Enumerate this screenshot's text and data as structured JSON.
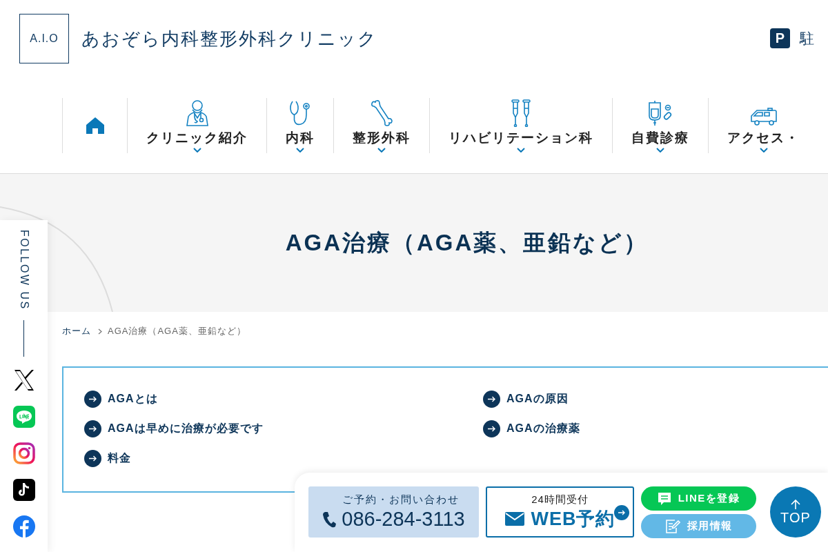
{
  "header": {
    "logo": "A.I.O",
    "clinic_name": "あおぞら内科整形外科クリニック",
    "parking_icon": "P",
    "parking_label": "駐"
  },
  "nav": [
    {
      "kind": "home",
      "has_submenu": false
    },
    {
      "kind": "doctor",
      "label": "クリニック紹介",
      "has_submenu": true
    },
    {
      "kind": "stethoscope",
      "label": "内科",
      "has_submenu": true
    },
    {
      "kind": "bone",
      "label": "整形外科",
      "has_submenu": true
    },
    {
      "kind": "crutches",
      "label": "リハビリテーション科",
      "has_submenu": true
    },
    {
      "kind": "drip",
      "label": "自費診療",
      "has_submenu": true
    },
    {
      "kind": "car",
      "label": "アクセス・",
      "has_submenu": true
    }
  ],
  "hero": {
    "title": "AGA治療（AGA薬、亜鉛など）"
  },
  "follow": {
    "label": "FOLLOW US",
    "links": [
      {
        "kind": "x"
      },
      {
        "kind": "line"
      },
      {
        "kind": "instagram"
      },
      {
        "kind": "tiktok"
      },
      {
        "kind": "facebook"
      }
    ]
  },
  "breadcrumb": [
    {
      "label": "ホーム",
      "kind": "link"
    },
    {
      "label": "AGA治療（AGA薬、亜鉛など）",
      "kind": "current"
    }
  ],
  "toc": [
    {
      "label": "AGAとは"
    },
    {
      "label": "AGAの原因"
    },
    {
      "label": "AGAは早めに治療が必要です"
    },
    {
      "label": "AGAの治療薬"
    },
    {
      "label": "料金"
    }
  ],
  "cta": {
    "phone_caption": "ご予約・お問い合わせ",
    "phone_number": "086-284-3113",
    "web_caption": "24時間受付",
    "web_label": "WEB予約",
    "line_label": "LINEを登録",
    "recruit_label": "採用情報",
    "top_label": "TOP"
  }
}
